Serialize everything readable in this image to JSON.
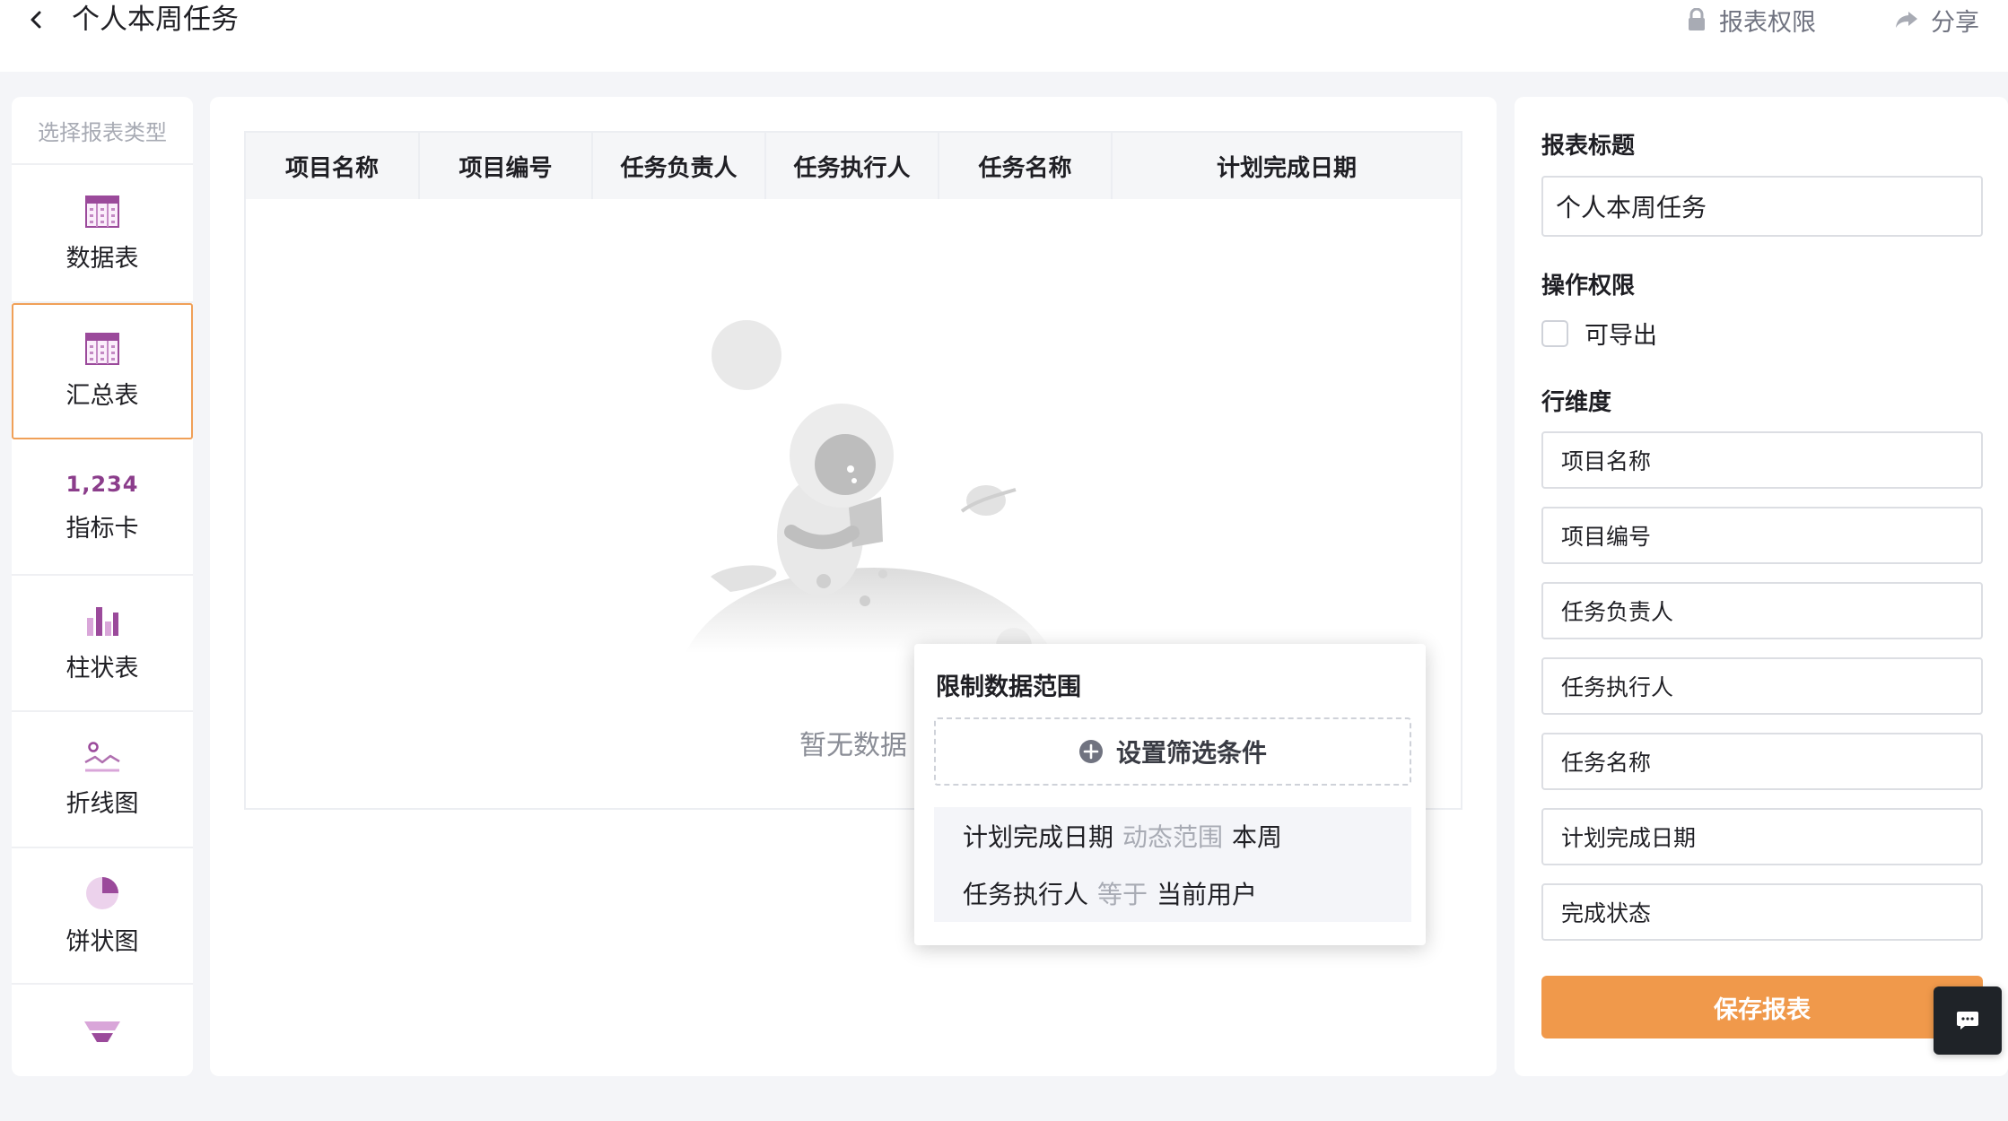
{
  "header": {
    "title": "个人本周任务",
    "permission_label": "报表权限",
    "share_label": "分享"
  },
  "sidebar": {
    "header": "选择报表类型",
    "items": [
      {
        "label": "数据表",
        "icon": "table-icon"
      },
      {
        "label": "汇总表",
        "icon": "summary-table-icon",
        "active": true
      },
      {
        "label": "指标卡",
        "icon": "metric-card-icon",
        "number": "1,234"
      },
      {
        "label": "柱状表",
        "icon": "bar-chart-icon"
      },
      {
        "label": "折线图",
        "icon": "line-chart-icon"
      },
      {
        "label": "饼状图",
        "icon": "pie-chart-icon"
      }
    ]
  },
  "table": {
    "columns": [
      "项目名称",
      "项目编号",
      "任务负责人",
      "任务执行人",
      "任务名称",
      "计划完成日期"
    ],
    "empty_text": "暂无数据"
  },
  "filter_popover": {
    "title": "限制数据范围",
    "add_label": "设置筛选条件",
    "conditions": [
      {
        "field": "计划完成日期",
        "operator": "动态范围",
        "value": "本周"
      },
      {
        "field": "任务执行人",
        "operator": "等于",
        "value": "当前用户"
      }
    ]
  },
  "config": {
    "title_label": "报表标题",
    "title_value": "个人本周任务",
    "permission_label": "操作权限",
    "export_label": "可导出",
    "row_dim_label": "行维度",
    "row_dims": [
      "项目名称",
      "项目编号",
      "任务负责人",
      "任务执行人",
      "任务名称",
      "计划完成日期",
      "完成状态"
    ],
    "save_label": "保存报表"
  },
  "colors": {
    "accent": "#f0994b",
    "active_border": "#f0a058",
    "icon_purple": "#8b3d8b"
  }
}
